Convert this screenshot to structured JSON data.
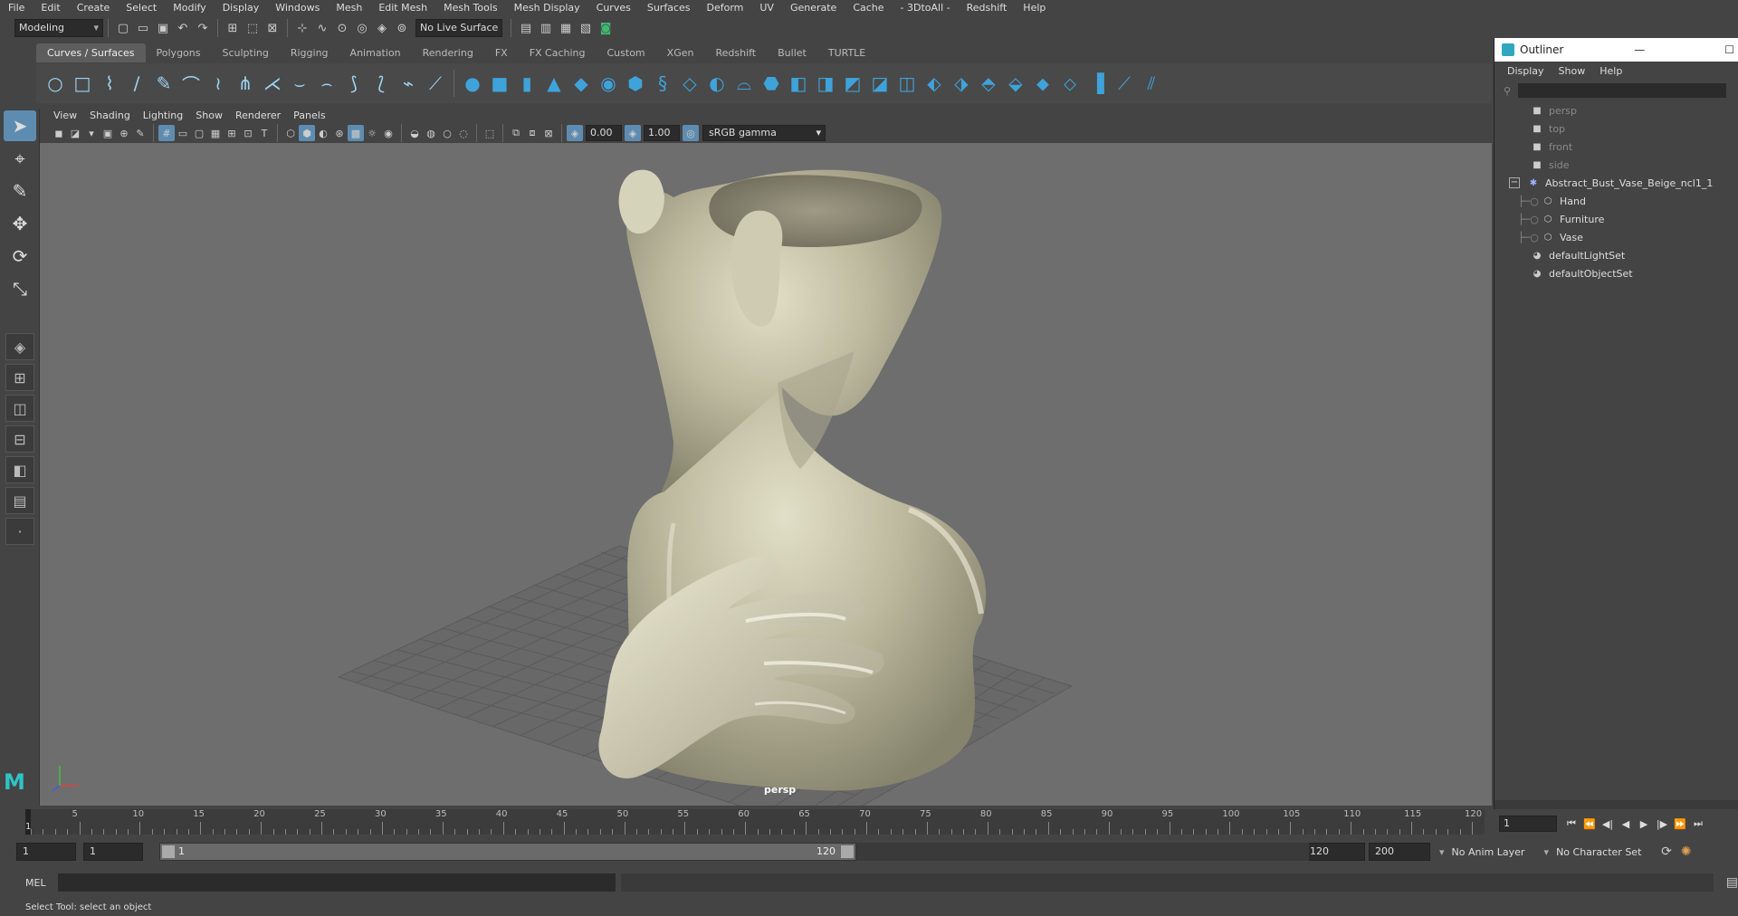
{
  "menus": [
    "File",
    "Edit",
    "Create",
    "Select",
    "Modify",
    "Display",
    "Windows",
    "Mesh",
    "Edit Mesh",
    "Mesh Tools",
    "Mesh Display",
    "Curves",
    "Surfaces",
    "Deform",
    "UV",
    "Generate",
    "Cache",
    "- 3DtoAll -",
    "Redshift",
    "Help"
  ],
  "toolbar": {
    "mode": "Modeling",
    "live_surface": "No Live Surface"
  },
  "shelf_tabs": [
    "Curves / Surfaces",
    "Polygons",
    "Sculpting",
    "Rigging",
    "Animation",
    "Rendering",
    "FX",
    "FX Caching",
    "Custom",
    "XGen",
    "Redshift",
    "Bullet",
    "TURTLE"
  ],
  "shelf_active": "Curves / Surfaces",
  "panel_menus": [
    "View",
    "Shading",
    "Lighting",
    "Show",
    "Renderer",
    "Panels"
  ],
  "panel_tools": {
    "exposure": "0.00",
    "gamma": "1.00",
    "color_space": "sRGB gamma"
  },
  "viewport": {
    "camera_label": "persp"
  },
  "outliner": {
    "title": "Outliner",
    "menus": [
      "Display",
      "Show",
      "Help"
    ],
    "items": [
      {
        "label": "persp",
        "icon": "camera-icon",
        "dim": true
      },
      {
        "label": "top",
        "icon": "camera-icon",
        "dim": true
      },
      {
        "label": "front",
        "icon": "camera-icon",
        "dim": true
      },
      {
        "label": "side",
        "icon": "camera-icon",
        "dim": true
      },
      {
        "label": "Abstract_Bust_Vase_Beige_ncl1_1",
        "icon": "group-icon",
        "dim": false
      },
      {
        "label": "Hand",
        "icon": "mesh-icon",
        "dim": false
      },
      {
        "label": "Furniture",
        "icon": "mesh-icon",
        "dim": false
      },
      {
        "label": "Vase",
        "icon": "mesh-icon",
        "dim": false
      },
      {
        "label": "defaultLightSet",
        "icon": "set-icon",
        "dim": false
      },
      {
        "label": "defaultObjectSet",
        "icon": "set-icon",
        "dim": false
      }
    ]
  },
  "timeline": {
    "ticks": [
      "5",
      "10",
      "15",
      "20",
      "25",
      "30",
      "35",
      "40",
      "45",
      "50",
      "55",
      "60",
      "65",
      "70",
      "75",
      "80",
      "85",
      "90",
      "95",
      "100",
      "105",
      "110",
      "115",
      "120"
    ],
    "current_frame": "1",
    "current_frame_field": "1"
  },
  "range": {
    "start": "1",
    "start_inner": "1",
    "slider_start": "1",
    "slider_end": "120",
    "end": "120",
    "end_outer": "200",
    "anim_layer": "No Anim Layer",
    "character_set": "No Character Set"
  },
  "command": {
    "label": "MEL"
  },
  "status": "Select Tool: select an object",
  "colors": {
    "accent": "#5e8cb1",
    "shelf_icon": "#3fa3db",
    "viewport_bg": "#6e6e6e",
    "model": "#c9c6ad"
  }
}
